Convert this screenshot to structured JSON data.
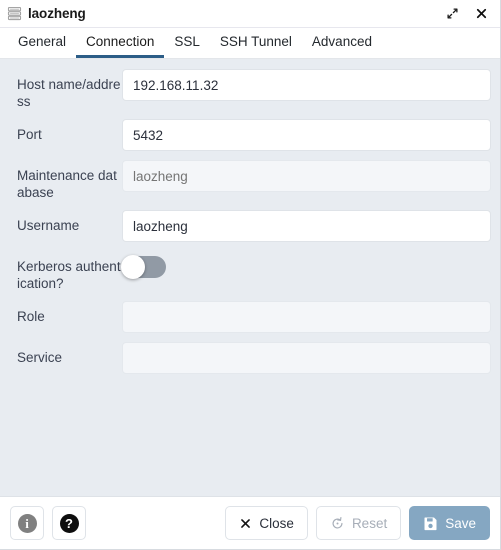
{
  "window": {
    "title": "laozheng",
    "icon": "database-icon",
    "expand_label": "expand-icon",
    "close_label": "close-icon"
  },
  "tabs": [
    {
      "label": "General",
      "active": false
    },
    {
      "label": "Connection",
      "active": true
    },
    {
      "label": "SSL",
      "active": false
    },
    {
      "label": "SSH Tunnel",
      "active": false
    },
    {
      "label": "Advanced",
      "active": false
    }
  ],
  "fields": {
    "host": {
      "label": "Host name/address",
      "value": "192.168.11.32",
      "placeholder": ""
    },
    "port": {
      "label": "Port",
      "value": "5432",
      "placeholder": ""
    },
    "maintenance_db": {
      "label": "Maintenance database",
      "value": "",
      "placeholder": "laozheng"
    },
    "username": {
      "label": "Username",
      "value": "laozheng",
      "placeholder": ""
    },
    "kerberos": {
      "label": "Kerberos authentication?",
      "state": "off"
    },
    "role": {
      "label": "Role",
      "value": "",
      "placeholder": ""
    },
    "service": {
      "label": "Service",
      "value": "",
      "placeholder": ""
    }
  },
  "footer": {
    "info_icon": "info-icon",
    "help_icon": "help-icon",
    "close_label": "Close",
    "reset_label": "Reset",
    "save_label": "Save"
  },
  "colors": {
    "active_tab_underline": "#2c5d87",
    "body_background": "#e8ecf1",
    "save_button": "#85a7c2",
    "toggle_track_off": "#919aa5"
  }
}
